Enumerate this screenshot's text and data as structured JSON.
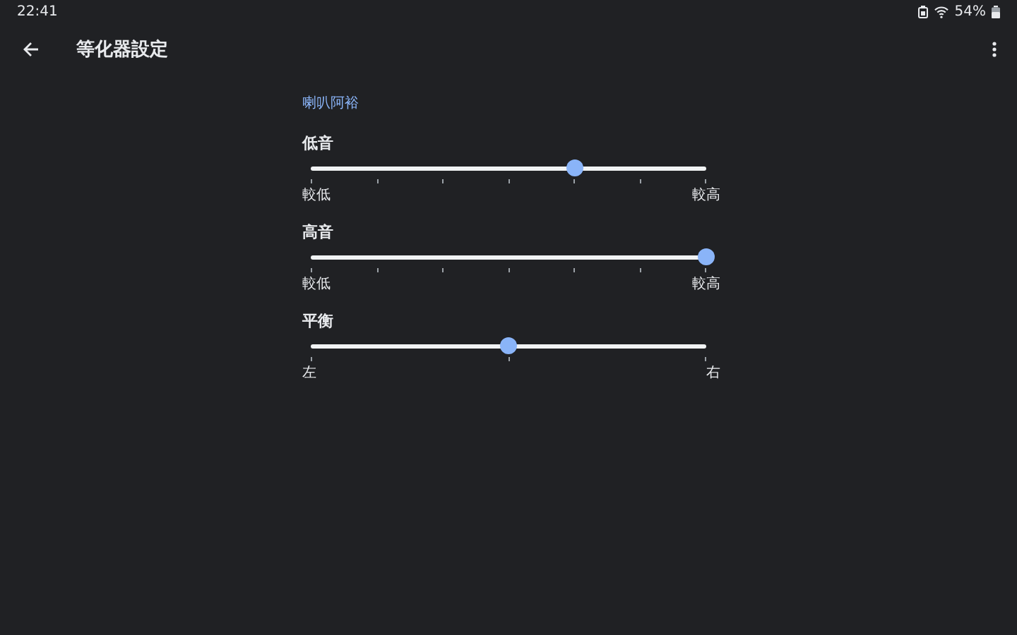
{
  "status_bar": {
    "time": "22:41",
    "battery": "54%"
  },
  "toolbar": {
    "title": "等化器設定"
  },
  "section": {
    "title": "喇叭阿裕"
  },
  "sliders": [
    {
      "label": "低音",
      "kind": "fine",
      "level": 0.667,
      "min_label": "較低",
      "max_label": "較高"
    },
    {
      "label": "高音",
      "kind": "fine",
      "level": 1,
      "min_label": "較低",
      "max_label": "較高"
    },
    {
      "label": "平衡",
      "kind": "coarse",
      "level": 0.5,
      "min_label": "左",
      "max_label": "右"
    }
  ]
}
